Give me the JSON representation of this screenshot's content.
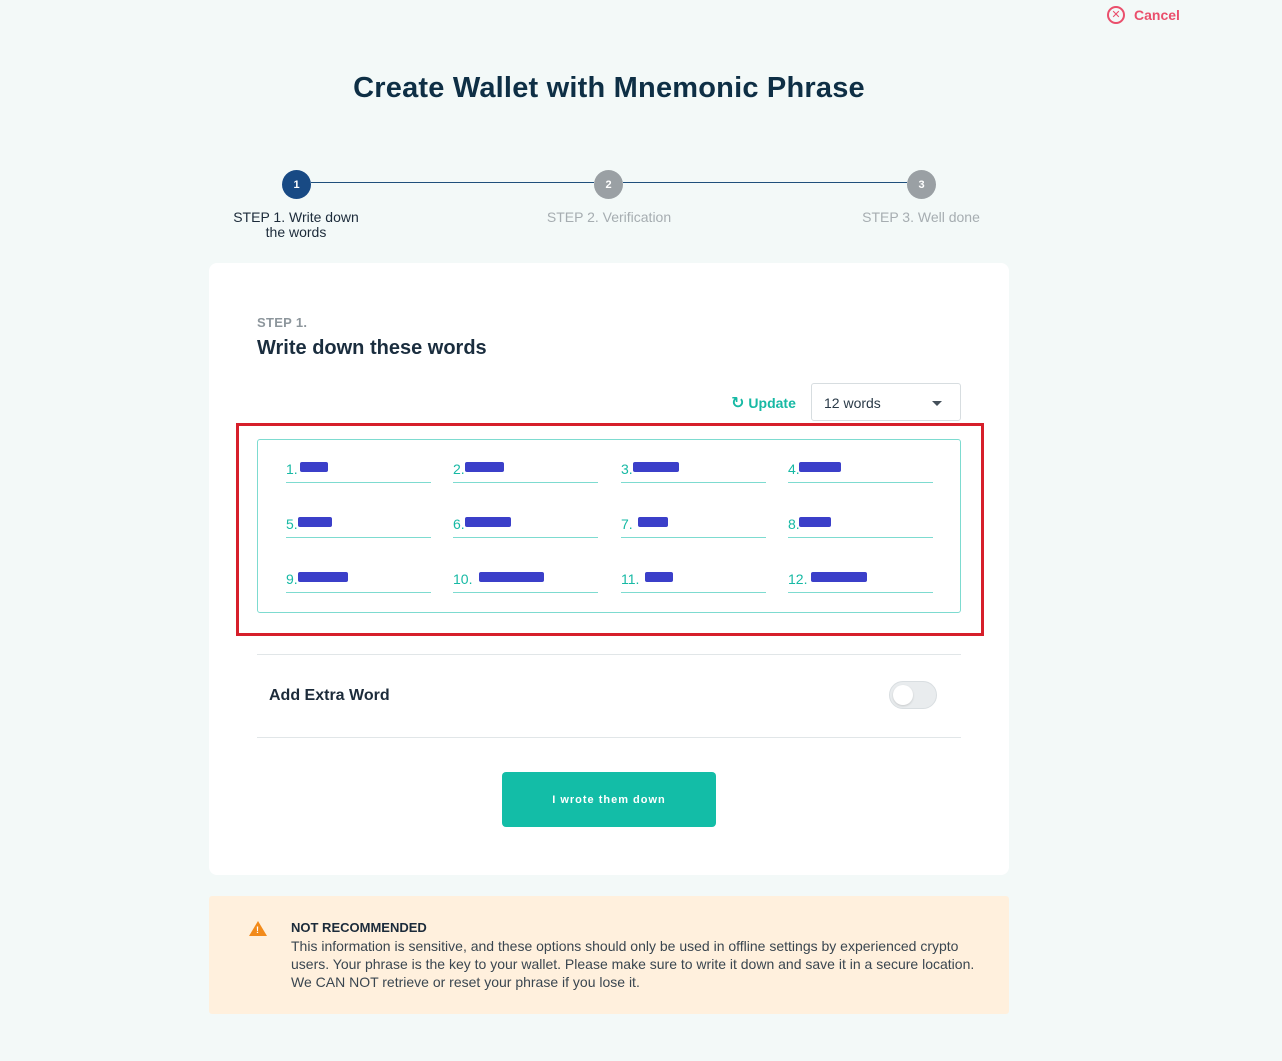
{
  "header": {
    "cancel_label": "Cancel",
    "title": "Create Wallet with Mnemonic Phrase"
  },
  "stepper": {
    "steps": [
      {
        "number": "1",
        "label_line1": "STEP 1. Write down",
        "label_line2": "the words",
        "state": "active"
      },
      {
        "number": "2",
        "label": "STEP 2. Verification",
        "state": "inactive"
      },
      {
        "number": "3",
        "label": "STEP 3. Well done",
        "state": "inactive"
      }
    ]
  },
  "card": {
    "step_small": "STEP 1.",
    "heading": "Write down these words",
    "update_label": "Update",
    "word_count_select": "12 words",
    "words": [
      {
        "num": "1."
      },
      {
        "num": "2."
      },
      {
        "num": "3."
      },
      {
        "num": "4."
      },
      {
        "num": "5."
      },
      {
        "num": "6."
      },
      {
        "num": "7."
      },
      {
        "num": "8."
      },
      {
        "num": "9."
      },
      {
        "num": "10."
      },
      {
        "num": "11."
      },
      {
        "num": "12."
      }
    ],
    "extra_word_label": "Add Extra Word",
    "extra_word_enabled": false,
    "confirm_button": "I wrote them down"
  },
  "warning": {
    "title": "NOT RECOMMENDED",
    "text": "This information is sensitive, and these options should only be used in offline settings by experienced crypto users. Your phrase is the key to your wallet. Please make sure to write it down and save it in a secure location. We CAN NOT retrieve or reset your phrase if you lose it."
  },
  "colors": {
    "accent": "#13bda7",
    "step_active": "#184a84",
    "cancel": "#ea4f6c",
    "highlight": "#d61f2a",
    "warning_bg": "#fff0dd"
  }
}
